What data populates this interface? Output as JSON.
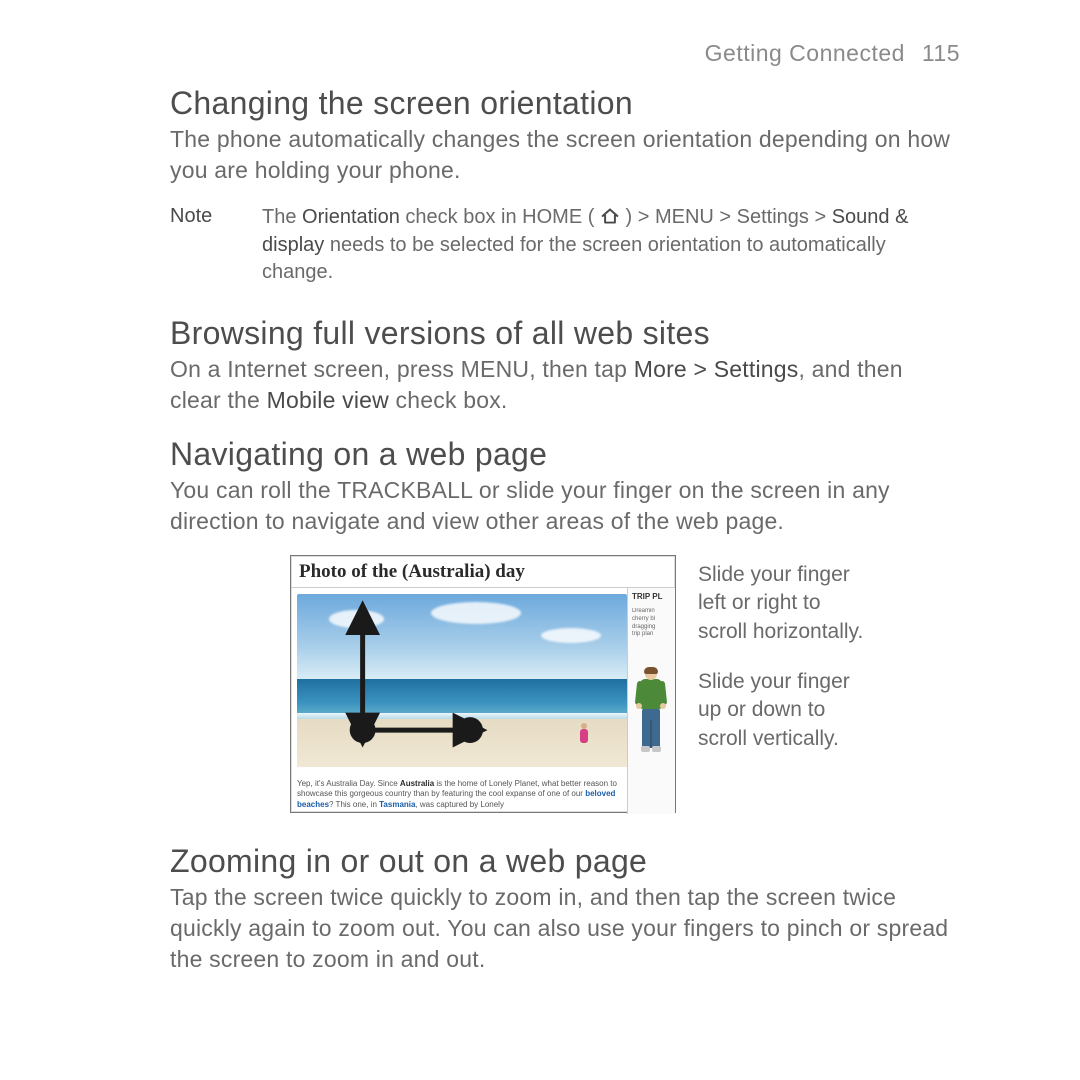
{
  "header": {
    "section": "Getting Connected",
    "page_number": "115"
  },
  "section1": {
    "title": "Changing the screen orientation",
    "body": "The phone automatically changes the screen orientation depending on how you are holding your phone."
  },
  "note": {
    "label": "Note",
    "pre": "The ",
    "orientation": "Orientation",
    "mid1": " check box in HOME ( ",
    "mid1b": " ) > MENU > Settings > ",
    "sound": "Sound & display",
    "post": " needs to be selected for the screen orientation to automatically change."
  },
  "section2": {
    "title": "Browsing full versions of all web sites",
    "p_pre": "On a Internet screen, press MENU, then tap ",
    "p_s1": "More > Settings",
    "p_mid": ", and then clear the ",
    "p_s2": "Mobile view",
    "p_post": " check box."
  },
  "section3": {
    "title": "Navigating on a web page",
    "body": "You can roll the TRACKBALL or slide your finger on the screen in any direction to navigate and view other areas of the web page."
  },
  "figure": {
    "browser_title": "Photo of the (Australia) day",
    "caption_pre": "Yep, it's Australia Day. Since ",
    "caption_s1": "Australia",
    "caption_mid1": " is the home of Lonely Planet, what better reason to showcase this gorgeous country than by featuring the cool expanse of one of our ",
    "caption_s2": "beloved beaches",
    "caption_mid2": "? This one, in ",
    "caption_s3": "Tasmania",
    "caption_post": ", was captured by Lonely",
    "sidebar_header": "TRIP PL",
    "sidebar_l1": "Dreamin",
    "sidebar_l2": "cherry bl",
    "sidebar_l3": "dragging",
    "sidebar_l4": "trip plan",
    "callout1": "Slide your finger left or right to scroll horizontally.",
    "callout2": "Slide your finger up or down to scroll vertically."
  },
  "section4": {
    "title": "Zooming in or out on a web page",
    "body": "Tap the screen twice quickly to zoom in, and then tap the screen twice quickly again to zoom out. You can also use your fingers to pinch or spread the screen to zoom in and out."
  }
}
